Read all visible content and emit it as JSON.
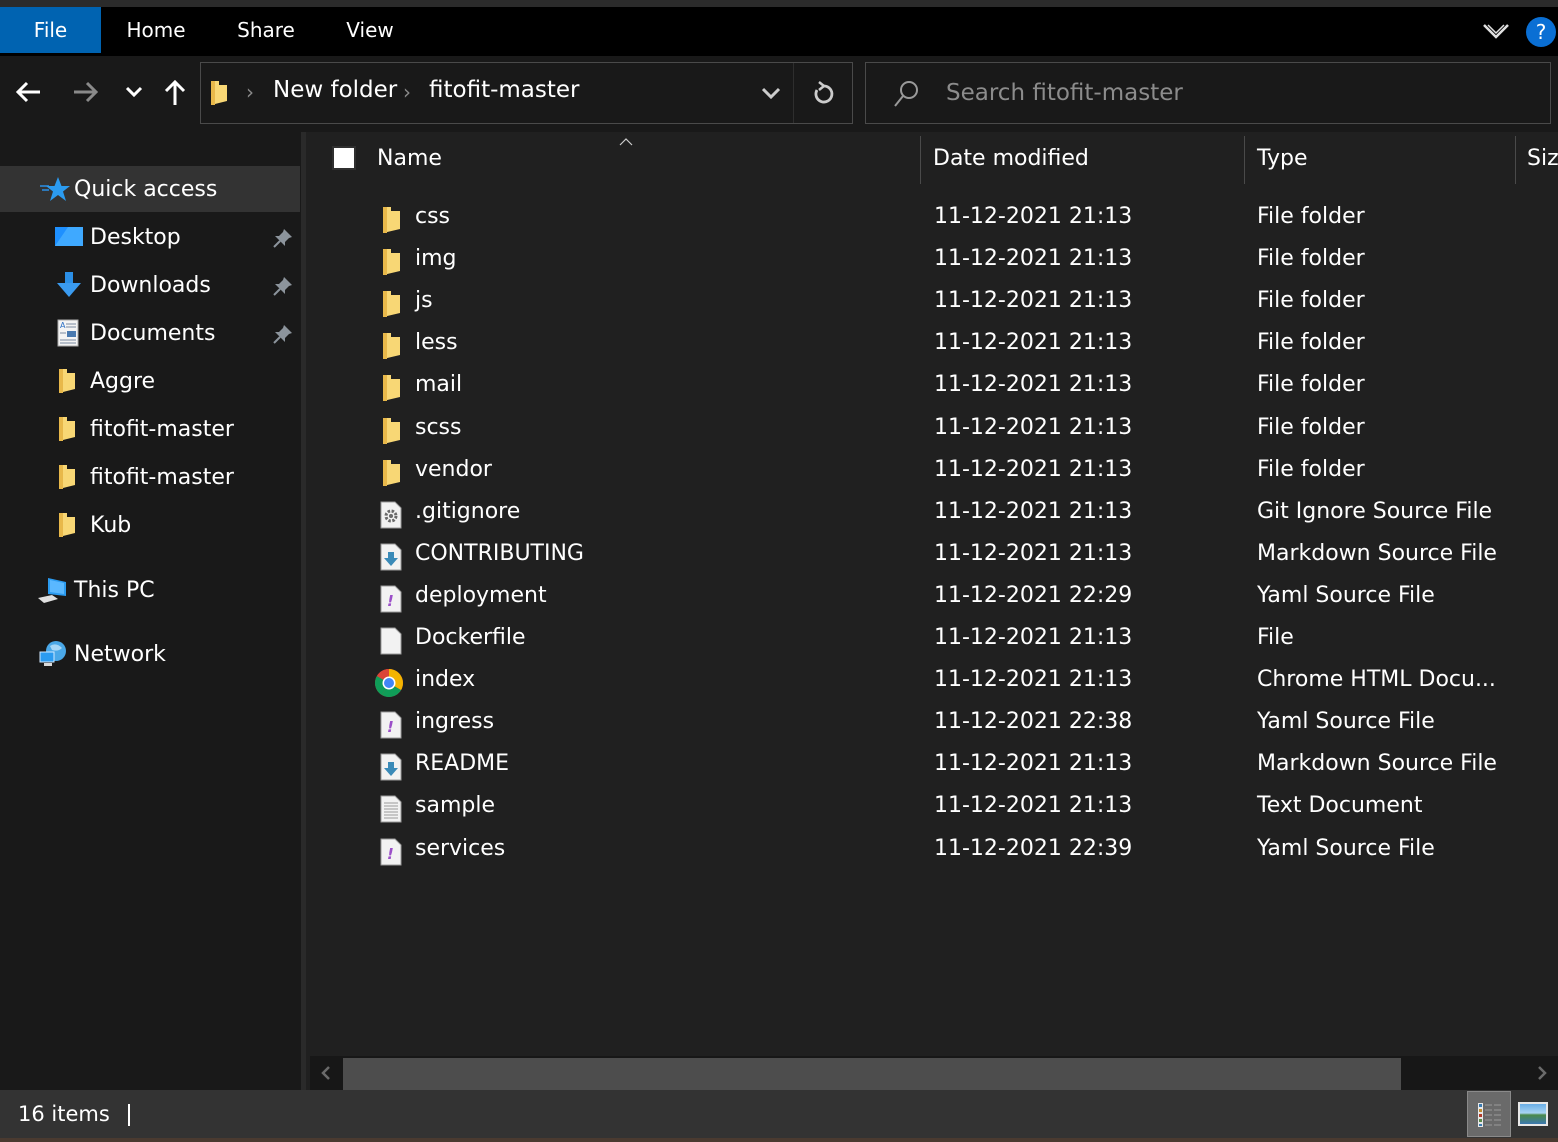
{
  "ribbon": {
    "tabs": [
      {
        "label": "File",
        "active": true
      },
      {
        "label": "Home",
        "active": false
      },
      {
        "label": "Share",
        "active": false
      },
      {
        "label": "View",
        "active": false
      }
    ],
    "help_label": "?",
    "accent_color": "#0063b1"
  },
  "navigation": {
    "back_icon": "arrow-left-icon",
    "forward_icon": "arrow-right-icon",
    "recent_icon": "chevron-down-icon",
    "up_icon": "arrow-up-icon"
  },
  "address_bar": {
    "breadcrumbs": [
      "New folder",
      "fitofit-master"
    ],
    "separator": "›"
  },
  "search": {
    "placeholder": "Search fitofit-master",
    "value": ""
  },
  "sidebar": {
    "quick_access": {
      "label": "Quick access",
      "icon": "star-icon",
      "selected": true
    },
    "items": [
      {
        "label": "Desktop",
        "icon": "desktop-icon",
        "pinned": true
      },
      {
        "label": "Downloads",
        "icon": "download-icon",
        "pinned": true
      },
      {
        "label": "Documents",
        "icon": "documents-icon",
        "pinned": true
      },
      {
        "label": "Aggre",
        "icon": "folder-icon",
        "pinned": false
      },
      {
        "label": "fitofit-master",
        "icon": "folder-icon",
        "pinned": false
      },
      {
        "label": "fitofit-master",
        "icon": "folder-icon",
        "pinned": false
      },
      {
        "label": "Kub",
        "icon": "folder-icon",
        "pinned": false
      }
    ],
    "this_pc": {
      "label": "This PC",
      "icon": "computer-icon"
    },
    "network": {
      "label": "Network",
      "icon": "network-icon"
    }
  },
  "file_list": {
    "columns": [
      "Name",
      "Date modified",
      "Type",
      "Siz"
    ],
    "sorted_by": "Name",
    "rows": [
      {
        "name": "css",
        "date": "11-12-2021 21:13",
        "type": "File folder",
        "icon": "folder-icon"
      },
      {
        "name": "img",
        "date": "11-12-2021 21:13",
        "type": "File folder",
        "icon": "folder-icon"
      },
      {
        "name": "js",
        "date": "11-12-2021 21:13",
        "type": "File folder",
        "icon": "folder-icon"
      },
      {
        "name": "less",
        "date": "11-12-2021 21:13",
        "type": "File folder",
        "icon": "folder-icon"
      },
      {
        "name": "mail",
        "date": "11-12-2021 21:13",
        "type": "File folder",
        "icon": "folder-icon"
      },
      {
        "name": "scss",
        "date": "11-12-2021 21:13",
        "type": "File folder",
        "icon": "folder-icon"
      },
      {
        "name": "vendor",
        "date": "11-12-2021 21:13",
        "type": "File folder",
        "icon": "folder-icon"
      },
      {
        "name": ".gitignore",
        "date": "11-12-2021 21:13",
        "type": "Git Ignore Source File",
        "icon": "gear-file-icon"
      },
      {
        "name": "CONTRIBUTING",
        "date": "11-12-2021 21:13",
        "type": "Markdown Source File",
        "icon": "markdown-file-icon"
      },
      {
        "name": "deployment",
        "date": "11-12-2021 22:29",
        "type": "Yaml Source File",
        "icon": "yaml-file-icon"
      },
      {
        "name": "Dockerfile",
        "date": "11-12-2021 21:13",
        "type": "File",
        "icon": "blank-file-icon"
      },
      {
        "name": "index",
        "date": "11-12-2021 21:13",
        "type": "Chrome HTML Docu...",
        "icon": "chrome-icon"
      },
      {
        "name": "ingress",
        "date": "11-12-2021 22:38",
        "type": "Yaml Source File",
        "icon": "yaml-file-icon"
      },
      {
        "name": "README",
        "date": "11-12-2021 21:13",
        "type": "Markdown Source File",
        "icon": "markdown-file-icon"
      },
      {
        "name": "sample",
        "date": "11-12-2021 21:13",
        "type": "Text Document",
        "icon": "text-file-icon"
      },
      {
        "name": "services",
        "date": "11-12-2021 22:39",
        "type": "Yaml Source File",
        "icon": "yaml-file-icon"
      }
    ]
  },
  "status_bar": {
    "item_count": "16 items",
    "active_view": "details"
  }
}
